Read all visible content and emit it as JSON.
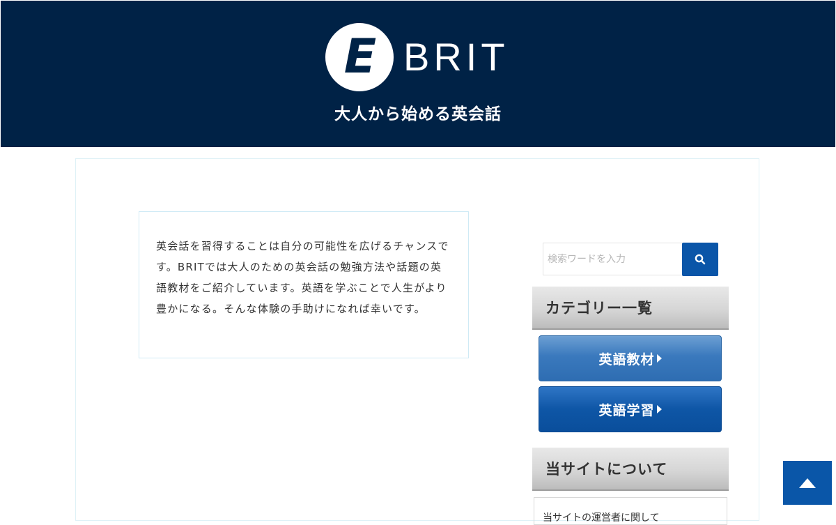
{
  "header": {
    "logo_mark": "E",
    "logo_text": "BRIT",
    "tagline": "大人から始める英会話",
    "background_color": "#002246"
  },
  "intro": {
    "text": "英会話を習得することは自分の可能性を広げるチャンスです。BRITでは大人のための英会話の勉強方法や話題の英語教材をご紹介しています。英語を学ぶことで人生がより豊かになる。そんな体験の手助けになれば幸いです。"
  },
  "search": {
    "placeholder": "検索ワードを入力",
    "button_icon": "search-icon"
  },
  "sidebar": {
    "category_title": "カテゴリー一覧",
    "categories": [
      {
        "label": "英語教材"
      },
      {
        "label": "英語学習"
      }
    ],
    "about_title": "当サイトについて",
    "about_text": "当サイトの運営者に関して"
  },
  "scroll_top": {
    "icon": "arrow-up-icon",
    "color": "#0a56a8"
  }
}
